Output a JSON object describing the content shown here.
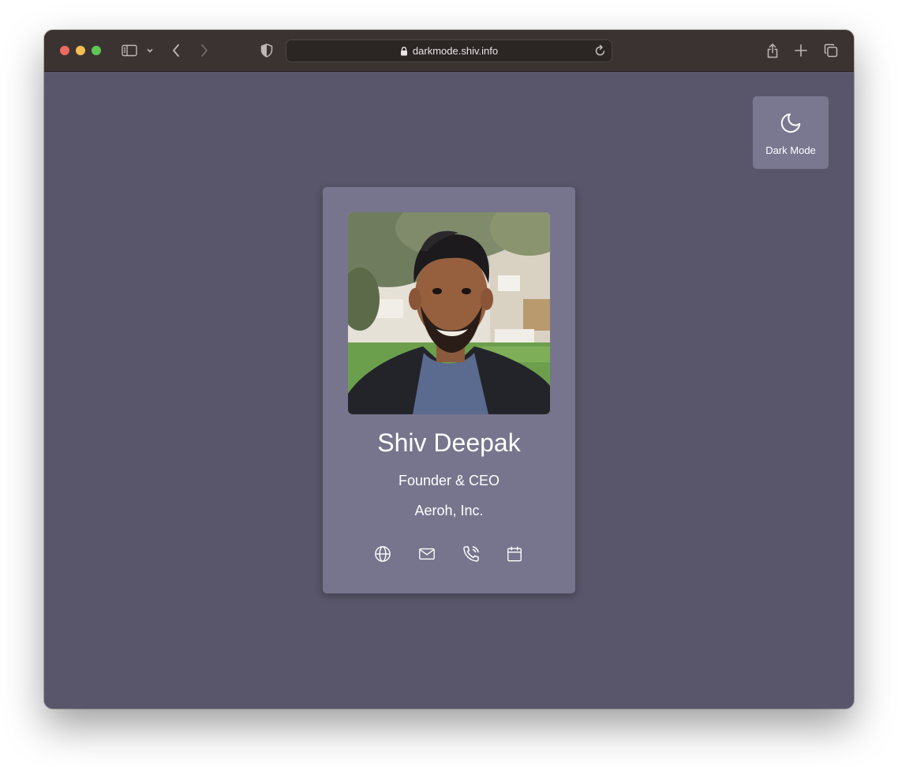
{
  "browser": {
    "url": "darkmode.shiv.info"
  },
  "toggle": {
    "label": "Dark Mode",
    "icon": "moon-icon"
  },
  "profile": {
    "name": "Shiv Deepak",
    "role": "Founder & CEO",
    "company": "Aeroh, Inc.",
    "links": [
      {
        "icon": "globe-icon"
      },
      {
        "icon": "mail-icon"
      },
      {
        "icon": "phone-icon"
      },
      {
        "icon": "calendar-icon"
      }
    ]
  },
  "colors": {
    "page_background": "#59566b",
    "card_background": "#77748d",
    "toolbar_background": "#3a3332",
    "text": "#ffffff"
  }
}
